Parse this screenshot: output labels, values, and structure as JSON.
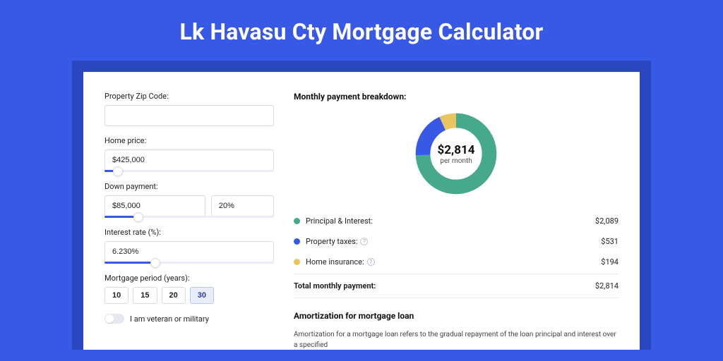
{
  "title": "Lk Havasu Cty Mortgage Calculator",
  "colors": {
    "principal": "#46a98b",
    "taxes": "#3759e6",
    "insurance": "#e9c561"
  },
  "form": {
    "zip": {
      "label": "Property Zip Code:",
      "value": ""
    },
    "price": {
      "label": "Home price:",
      "value": "$425,000",
      "slider_pct": 8
    },
    "down": {
      "label": "Down payment:",
      "amount": "$85,000",
      "percent": "20%",
      "slider_pct": 20
    },
    "rate": {
      "label": "Interest rate (%):",
      "value": "6.230%",
      "slider_pct": 30
    },
    "period": {
      "label": "Mortgage period (years):",
      "options": [
        "10",
        "15",
        "20",
        "30"
      ],
      "active": "30"
    },
    "veteran": {
      "label": "I am veteran or military",
      "on": false
    }
  },
  "breakdown": {
    "title": "Monthly payment breakdown:",
    "center_value": "$2,814",
    "center_sub": "per month",
    "rows": [
      {
        "key": "principal",
        "label": "Principal & Interest:",
        "value": "$2,089",
        "info": false
      },
      {
        "key": "taxes",
        "label": "Property taxes:",
        "value": "$531",
        "info": true
      },
      {
        "key": "insurance",
        "label": "Home insurance:",
        "value": "$194",
        "info": true
      }
    ],
    "total_label": "Total monthly payment:",
    "total_value": "$2,814"
  },
  "amortization": {
    "title": "Amortization for mortgage loan",
    "text": "Amortization for a mortgage loan refers to the gradual repayment of the loan principal and interest over a specified"
  },
  "chart_data": {
    "type": "pie",
    "title": "Monthly payment breakdown",
    "series": [
      {
        "name": "Principal & Interest",
        "value": 2089,
        "color": "#46a98b"
      },
      {
        "name": "Property taxes",
        "value": 531,
        "color": "#3759e6"
      },
      {
        "name": "Home insurance",
        "value": 194,
        "color": "#e9c561"
      }
    ],
    "total": 2814,
    "center_label": "$2,814 per month"
  }
}
